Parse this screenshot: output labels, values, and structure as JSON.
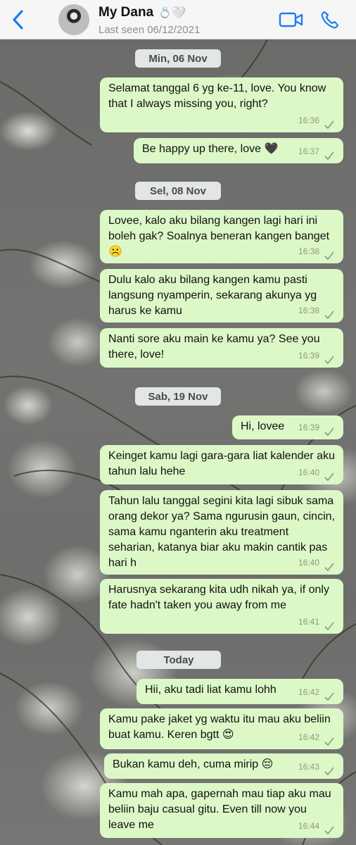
{
  "header": {
    "contact_name": "My Dana",
    "name_emoji_ring": "💍",
    "name_emoji_heart": "🤍",
    "last_seen": "Last seen 06/12/2021",
    "back_icon": "chevron-left-icon",
    "video_icon": "video-camera-icon",
    "call_icon": "phone-icon",
    "accent_color": "#1a7cf5"
  },
  "bubble_color": "#dcf8c6",
  "dates": {
    "d1": "Min, 06 Nov",
    "d2": "Sel, 08 Nov",
    "d3": "Sab, 19 Nov",
    "d4": "Today"
  },
  "messages": [
    {
      "text": "Selamat tanggal 6 yg ke-11, love. You know that I always missing you, right?",
      "time": "16:36"
    },
    {
      "text": "Be happy up there, love 🖤",
      "time": "16:37"
    },
    {
      "text": "Lovee, kalo aku bilang kangen lagi hari ini boleh gak? Soalnya beneran kangen banget ☹️",
      "time": "16:38"
    },
    {
      "text": "Dulu kalo aku bilang kangen kamu pasti langsung nyamperin, sekarang akunya yg harus ke kamu",
      "time": "16:38"
    },
    {
      "text": "Nanti sore aku main ke kamu ya? See you there, love!",
      "time": "16:39"
    },
    {
      "text": "Hi, lovee",
      "time": "16:39"
    },
    {
      "text": "Keinget kamu lagi gara-gara liat kalender aku tahun lalu hehe",
      "time": "16:40"
    },
    {
      "text": "Tahun lalu tanggal segini kita lagi sibuk sama orang dekor ya? Sama ngurusin gaun, cincin, sama kamu nganterin aku treatment seharian, katanya biar aku makin cantik pas hari h",
      "time": "16:40"
    },
    {
      "text": "Harusnya sekarang kita udh nikah ya, if only fate hadn't taken you away from me",
      "time": "16:41"
    },
    {
      "text": "Hii, aku tadi liat kamu lohh",
      "time": "16:42"
    },
    {
      "text": "Kamu pake jaket yg waktu itu mau aku beliin buat kamu. Keren bgtt 😍",
      "time": "16:42"
    },
    {
      "text": "Bukan kamu deh, cuma mirip 😔",
      "time": "16:43"
    },
    {
      "text": "Kamu mah apa, gapernah mau tiap aku mau beliin baju casual gitu. Even till now you leave me",
      "time": "16:44"
    }
  ]
}
